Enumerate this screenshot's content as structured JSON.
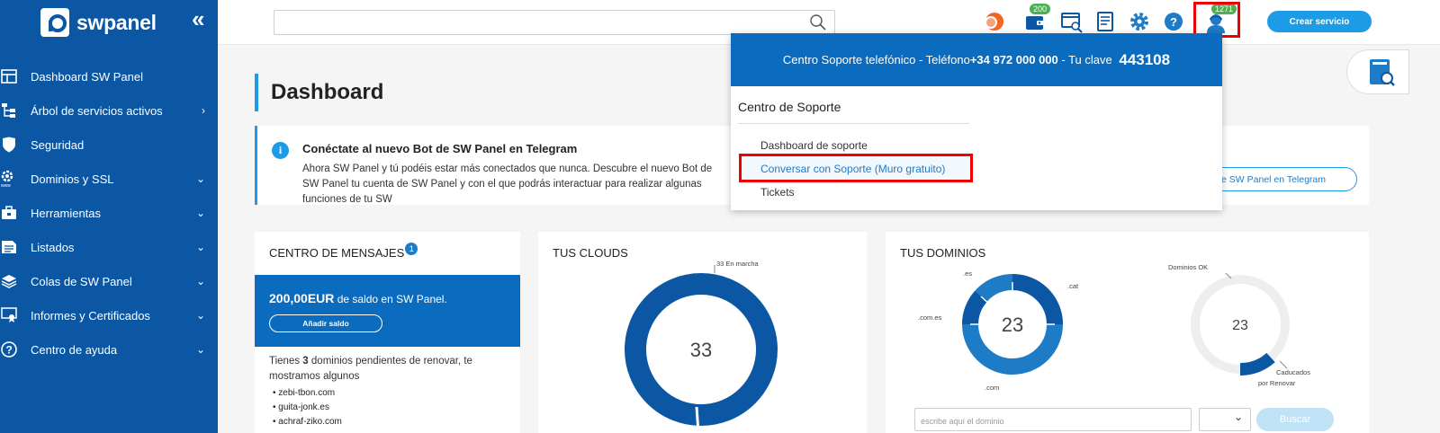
{
  "sidebar": {
    "logo_text": "swpanel",
    "collapse_glyph": "«",
    "items": [
      {
        "label": "Dashboard SW Panel",
        "icon": "dashboard-icon",
        "arrow": ""
      },
      {
        "label": "Árbol de servicios activos",
        "icon": "tree-icon",
        "arrow": "›"
      },
      {
        "label": "Seguridad",
        "icon": "shield-icon",
        "arrow": ""
      },
      {
        "label": "Dominios y SSL",
        "icon": "gear-www-icon",
        "arrow": "⌄"
      },
      {
        "label": "Herramientas",
        "icon": "toolbox-icon",
        "arrow": "⌄"
      },
      {
        "label": "Listados",
        "icon": "list-icon",
        "arrow": "⌄"
      },
      {
        "label": "Colas de SW Panel",
        "icon": "layers-icon",
        "arrow": "⌄"
      },
      {
        "label": "Informes y Certificados",
        "icon": "certificate-icon",
        "arrow": "⌄"
      },
      {
        "label": "Centro de ayuda",
        "icon": "help-icon",
        "arrow": "⌄"
      }
    ]
  },
  "topbar": {
    "search_placeholder": "",
    "wallet_badge": "200",
    "user_badge": "1271",
    "create_label": "Crear servicio"
  },
  "page": {
    "title": "Dashboard"
  },
  "notice": {
    "title": "Conéctate al nuevo Bot de SW Panel en Telegram",
    "text": "Ahora SW Panel y tú podéis estar más conectados que nunca. Descubre el nuevo Bot de SW Panel tu cuenta de SW Panel y con el que podrás interactuar para realizar algunas funciones de tu SW",
    "button": "e SW Panel en Telegram"
  },
  "messages": {
    "title": "CENTRO DE MENSAJES",
    "count": "1",
    "balance_amount": "200,00EUR",
    "balance_suffix": " de saldo en SW Panel.",
    "add_balance": "Añadir saldo",
    "pending_prefix": "Tienes ",
    "pending_count": "3",
    "pending_suffix": " dominios pendientes de renovar, te mostramos algunos",
    "domains": [
      "zebi-tbon.com",
      "guita-jonk.es",
      "achraf-ziko.com"
    ]
  },
  "clouds": {
    "title": "TUS CLOUDS",
    "total": "33",
    "label_running": "33 En marcha"
  },
  "domains": {
    "title": "TUS DOMINIOS",
    "total_left": "23",
    "total_right": "23",
    "label_es": ".es",
    "label_cat": ".cat",
    "label_comes": ".com.es",
    "label_com": ".com",
    "label_ok": "Dominios OK",
    "label_expired": "Caducados",
    "label_renew": "por Renovar",
    "input_placeholder": "escribe aquí el dominio",
    "search_button": "Buscar"
  },
  "support": {
    "header_prefix": "Centro Soporte telefónico - Teléfono ",
    "phone": "+34 972 000 000",
    "header_mid": " - Tu clave ",
    "key": "443108",
    "title": "Centro de Soporte",
    "items": [
      "Dashboard de soporte",
      "Conversar con Soporte (Muro gratuito)",
      "Tickets"
    ]
  },
  "colors": {
    "sidebar": "#0b57a4",
    "accent": "#1e9be6",
    "highlight": "#ee0000"
  }
}
